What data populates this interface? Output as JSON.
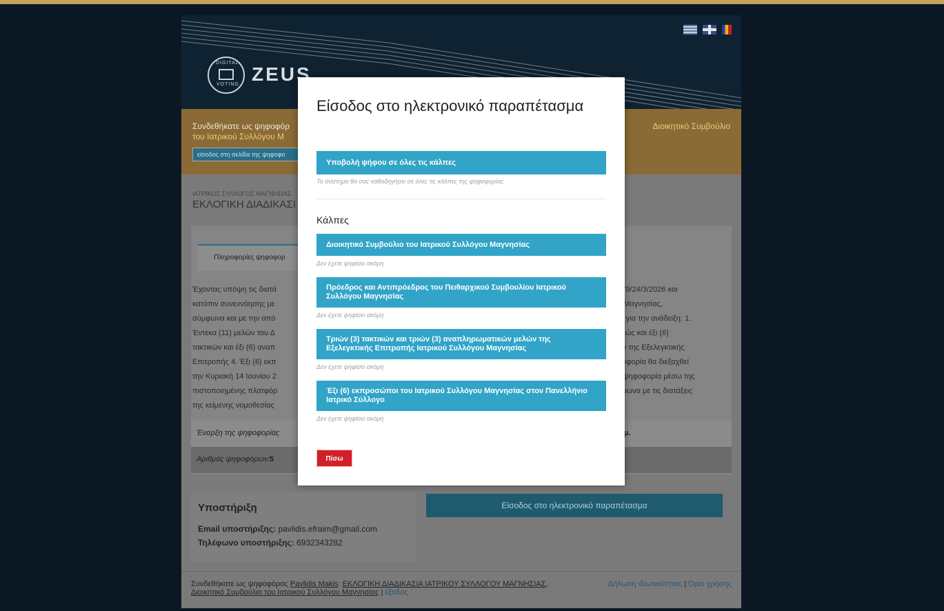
{
  "app": {
    "logo_text": "ZEUS",
    "logo_ring_top": "DIGITAL",
    "logo_ring_bottom": "VOTING",
    "flags": [
      "greek-flag-icon",
      "uk-flag-icon",
      "romanian-flag-icon"
    ]
  },
  "banner": {
    "text_visible": "Συνδεθήκατε ως ψηφοφόρ",
    "text_highlight_left": "του Ιατρικού Συλλόγου Μ",
    "text_highlight_right": "Διοικητικό Συμβούλιο",
    "button_label": "είσοδος στη σελίδα της ψηφοφο"
  },
  "election": {
    "org": "ΙΑΤΡΙΚΟΣ ΣΥΛΛΟΓΟΣ ΜΑΓΝΗΣΙΑΣ",
    "title": "ΕΚΛΟΓΙΚΗ ΔΙΑΔΙΚΑΣΙ",
    "tab_label": "Πληροφορίες ψηφοφορ",
    "body_left": [
      "Έχοντας υπόψη τις διατά",
      "κατόπιν συνεννόησης με",
      "σύμφωνα και με την από",
      "Έντεκα (11) μελών του Δ",
      "τακτικών και έξι (6) αναπ",
      "Επιτροπής 4. Έξι (6) εκπ",
      "την Κυριακή 14 Ιουνίου 2",
      "πιστοποιημένης πλατφόρ",
      "της κείμενης νομοθεσίας"
    ],
    "body_right": [
      "1479/24/3/2026 και",
      "ου Μαγνησίας,",
      "γές για την ανάδειξη: 1.",
      "καθώς και έξι (6)",
      "λών της Εξελεγκτικής",
      "ηφοφορία θα διεξαχθεί",
      "κή ψηφοφορία μέσω της",
      "ύμφωνα με τις διατάξεις",
      ""
    ],
    "start_label": "Έναρξη της ψηφοφορίας",
    "start_right": "2 μμ.",
    "voters_label": "Αριθμός ψηφοφόρων:",
    "voters_count": "5"
  },
  "support": {
    "title": "Υποστήριξη",
    "email_label": "Email υποστήριξης:",
    "email": "pavlidis.efraim@gmail.com",
    "phone_label": "Τηλέφωνο υποστήριξης:",
    "phone": "6932343282"
  },
  "enter_booth_label": "Είσοδος στο ηλεκτρονικό παραπέτασμα",
  "footer": {
    "prefix": "Συνδεθήκατε ως ψηφοφόρος",
    "voter": "Pavlidis Makis",
    "election": "ΕΚΛΟΓΙΚΗ ΔΙΑΔΙΚΑΣΙΑ ΙΑΤΡΙΚΟΥ ΣΥΛΛΟΓΟΥ ΜΑΓΝΗΣΙΑΣ",
    "poll": "Διοικητικό Συμβούλιο του Ιατρικού Συλλόγου Μαγνησίας",
    "sep": "|",
    "logout": "έξοδος",
    "privacy": "Δήλωση ιδιωτικότητας",
    "terms": "Όροι χρήσης"
  },
  "modal": {
    "title": "Είσοδος στο ηλεκτρονικό παραπέτασμα",
    "vote_all_label": "Υποβολή ψήφου σε όλες τις κάλπες",
    "vote_all_hint": "Το σύστημα θα σας καθοδηγήσει σε όλες τις κάλπες της ψηφοφορίας",
    "section_title": "Κάλπες",
    "polls": [
      {
        "label": "Διοικητικό Συμβούλιο του Ιατρικού Συλλόγου Μαγνησίας",
        "status": "Δεν έχετε ψηφίσει ακόμη"
      },
      {
        "label": "Πρόεδρος και Αντιπρόεδρος του Πειθαρχικού Συμβουλίου Ιατρικού Συλλόγου Μαγνησίας",
        "status": "Δεν έχετε ψηφίσει ακόμη"
      },
      {
        "label": "Τριών (3) τακτικών και τριών (3) αναπληρωματικών μελών της Εξελεγκτικής Επιτροπής Ιατρικού Συλλόγου Μαγνησίας",
        "status": "Δεν έχετε ψηφίσει ακόμη"
      },
      {
        "label": "Έξι (6) εκπροσώποι του Ιατρικού Συλλόγου Μαγνησίας στον Πανελλήνιο Ιατρικό Σύλλογο",
        "status": "Δεν έχετε ψηφίσει ακόμη"
      }
    ],
    "back_label": "Πίσω"
  },
  "colors": {
    "accent_blue": "#31a4c8",
    "danger": "#d0202a",
    "top_stripe": "#c6a25a"
  }
}
